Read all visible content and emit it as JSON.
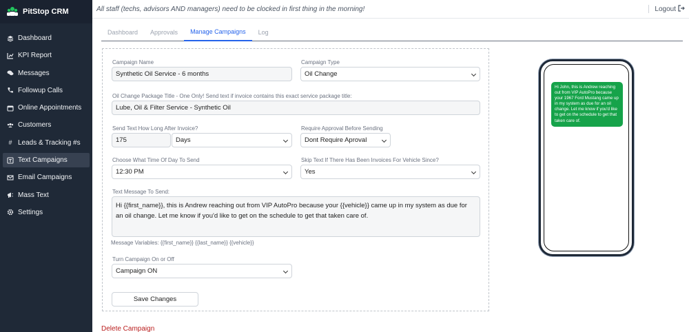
{
  "app": {
    "name": "PitStop CRM"
  },
  "sidebar": {
    "items": [
      {
        "label": "Dashboard",
        "icon": "layers-icon"
      },
      {
        "label": "KPI Report",
        "icon": "chart-icon"
      },
      {
        "label": "Messages",
        "icon": "comments-icon"
      },
      {
        "label": "Followup Calls",
        "icon": "phone-icon"
      },
      {
        "label": "Online Appointments",
        "icon": "calendar-icon"
      },
      {
        "label": "Customers",
        "icon": "users-icon"
      },
      {
        "label": "Leads & Tracking #s",
        "icon": "hashtag-icon"
      },
      {
        "label": "Text Campaigns",
        "icon": "text-icon"
      },
      {
        "label": "Email Campaigns",
        "icon": "envelope-icon"
      },
      {
        "label": "Mass Text",
        "icon": "bullhorn-icon"
      },
      {
        "label": "Settings",
        "icon": "gear-icon"
      }
    ],
    "active_index": 7
  },
  "topbar": {
    "notice": "All staff (techs, advisors AND managers) need to be clocked in first thing in the morning!",
    "logout_label": "Logout"
  },
  "tabs": [
    {
      "label": "Dashboard"
    },
    {
      "label": "Approvals"
    },
    {
      "label": "Manage Campaigns"
    },
    {
      "label": "Log"
    }
  ],
  "form": {
    "campaign_name_label": "Campaign Name",
    "campaign_name_value": "Synthetic Oil Service - 6 months",
    "campaign_type_label": "Campaign Type",
    "campaign_type_value": "Oil Change",
    "package_title_label": "Oil Change Package Title - One Only! Send text if invoice contains this exact service package title:",
    "package_title_value": "Lube, Oil & Filter Service - Synthetic Oil",
    "send_after_label": "Send Text How Long After Invoice?",
    "send_after_value": "175",
    "send_after_unit": "Days",
    "approval_label": "Require Approval Before Sending",
    "approval_value": "Dont Require Aproval",
    "time_label": "Choose What Time Of Day To Send",
    "time_value": "12:30 PM",
    "skip_label": "Skip Text If There Has Been Invoices For Vehicle Since?",
    "skip_value": "Yes",
    "message_label": "Text Message To Send:",
    "message_value": "Hi {{first_name}}, this is Andrew reaching out from VIP AutoPro because your {{vehicle}} came up in my system as due for an oil change. Let me know if you'd like to get on the schedule to get that taken care of.",
    "variables_text": "Message Variables: {{first_name}} {{last_name}} {{vehicle}}",
    "toggle_label": "Turn Campaign On or Off",
    "toggle_value": "Campaign ON",
    "save_label": "Save Changes",
    "delete_label": "Delete Campaign"
  },
  "preview": {
    "message": "Hi John, this is Andrew reaching out from VIP AutoPro because your 1967 Ford Mustang came up in my system as due for an oil change. Let me know if you'd like to get on the schedule to get that taken care of.",
    "bubble_color": "#16a34a"
  },
  "colors": {
    "sidebar_bg": "#1f2937",
    "accent": "#2563eb",
    "danger": "#b91c1c"
  }
}
